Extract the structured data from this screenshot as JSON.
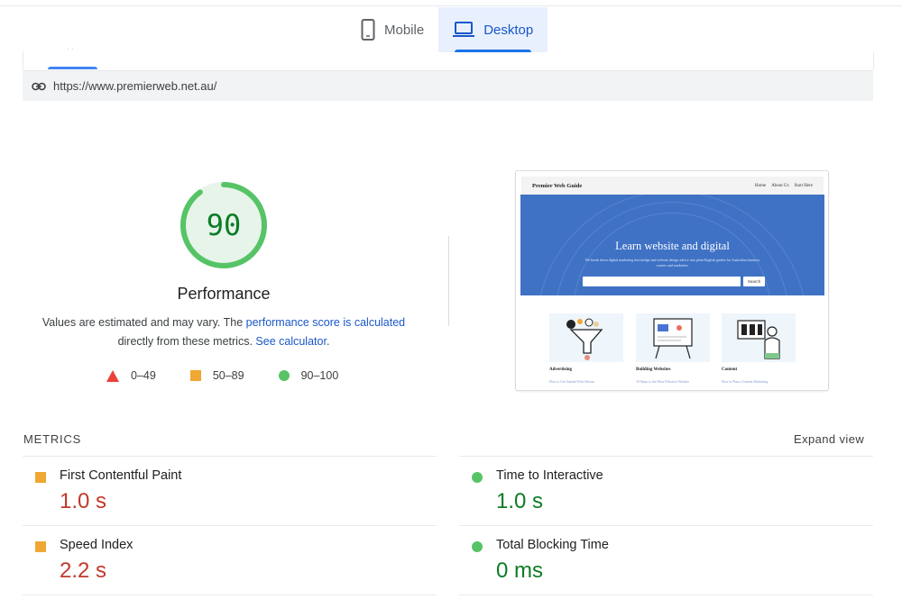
{
  "tabs": [
    {
      "label": "Mobile",
      "icon": "phone-icon",
      "active": false
    },
    {
      "label": "Desktop",
      "icon": "laptop-icon",
      "active": true
    }
  ],
  "url": "https://www.premierweb.net.au/",
  "score": {
    "value": "90",
    "fraction": 0.9,
    "title": "Performance",
    "desc_before": "Values are estimated and may vary. The ",
    "desc_link1": "performance score is calculated",
    "desc_middle": " directly from these metrics. ",
    "desc_link2": "See calculator",
    "desc_after": ".",
    "color": "#0d7c26",
    "ring_color": "#56c466",
    "ring_bg": "#e6f4ea"
  },
  "legend": [
    {
      "shape": "triangle",
      "range": "0–49",
      "color": "#eb4236"
    },
    {
      "shape": "square",
      "range": "50–89",
      "color": "#f0a733"
    },
    {
      "shape": "circle",
      "range": "90–100",
      "color": "#56c466"
    }
  ],
  "screenshot": {
    "brand": "Premier Web Guide",
    "nav": [
      "Home",
      "About Us",
      "Start Here"
    ],
    "headline": "Learn website and digital",
    "sub": "We break down digital marketing knowledge and website design advice into plain English guides for Australian business owners and marketers.",
    "search_button": "Search",
    "cards": [
      {
        "title": "Advertising",
        "link": "How to Get Started With Adwise"
      },
      {
        "title": "Building Websites",
        "link": "10 Steps to the Most Effective Website"
      },
      {
        "title": "Content",
        "link": "How to Plan a Content Marketing"
      }
    ]
  },
  "metrics_label": "METRICS",
  "expand_label": "Expand view",
  "metrics": [
    {
      "name": "First Contentful Paint",
      "value": "1.0 s",
      "status": "average"
    },
    {
      "name": "Time to Interactive",
      "value": "1.0 s",
      "status": "good"
    },
    {
      "name": "Speed Index",
      "value": "2.2 s",
      "status": "average"
    },
    {
      "name": "Total Blocking Time",
      "value": "0 ms",
      "status": "good"
    }
  ]
}
